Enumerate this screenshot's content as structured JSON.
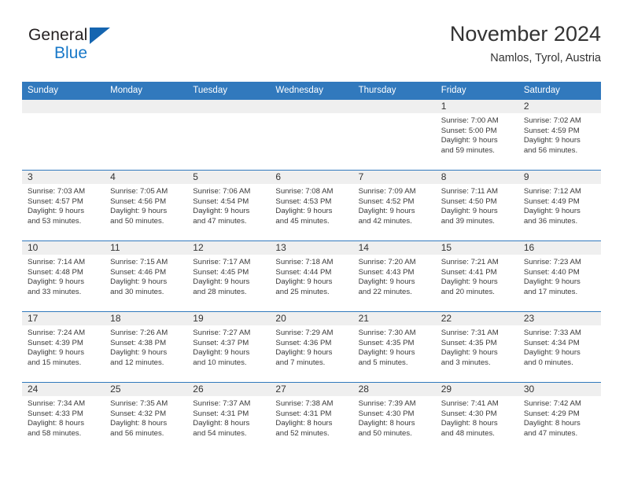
{
  "brand": {
    "name_top": "General",
    "name_bottom": "Blue",
    "triangle_icon": "triangle-icon",
    "accent_color": "#1878c8",
    "triangle_color": "#1565b0"
  },
  "header": {
    "title": "November 2024",
    "subtitle": "Namlos, Tyrol, Austria"
  },
  "calendar": {
    "header_bg_color": "#3179bd",
    "daynum_bg_color": "#efefef",
    "weekday_headers": [
      "Sunday",
      "Monday",
      "Tuesday",
      "Wednesday",
      "Thursday",
      "Friday",
      "Saturday"
    ],
    "weeks": [
      [
        {
          "day": "",
          "empty": true,
          "sunrise": "",
          "sunset": "",
          "daylight_line1": "",
          "daylight_line2": ""
        },
        {
          "day": "",
          "empty": true,
          "sunrise": "",
          "sunset": "",
          "daylight_line1": "",
          "daylight_line2": ""
        },
        {
          "day": "",
          "empty": true,
          "sunrise": "",
          "sunset": "",
          "daylight_line1": "",
          "daylight_line2": ""
        },
        {
          "day": "",
          "empty": true,
          "sunrise": "",
          "sunset": "",
          "daylight_line1": "",
          "daylight_line2": ""
        },
        {
          "day": "",
          "empty": true,
          "sunrise": "",
          "sunset": "",
          "daylight_line1": "",
          "daylight_line2": ""
        },
        {
          "day": "1",
          "empty": false,
          "sunrise": "Sunrise: 7:00 AM",
          "sunset": "Sunset: 5:00 PM",
          "daylight_line1": "Daylight: 9 hours",
          "daylight_line2": "and 59 minutes."
        },
        {
          "day": "2",
          "empty": false,
          "sunrise": "Sunrise: 7:02 AM",
          "sunset": "Sunset: 4:59 PM",
          "daylight_line1": "Daylight: 9 hours",
          "daylight_line2": "and 56 minutes."
        }
      ],
      [
        {
          "day": "3",
          "empty": false,
          "sunrise": "Sunrise: 7:03 AM",
          "sunset": "Sunset: 4:57 PM",
          "daylight_line1": "Daylight: 9 hours",
          "daylight_line2": "and 53 minutes."
        },
        {
          "day": "4",
          "empty": false,
          "sunrise": "Sunrise: 7:05 AM",
          "sunset": "Sunset: 4:56 PM",
          "daylight_line1": "Daylight: 9 hours",
          "daylight_line2": "and 50 minutes."
        },
        {
          "day": "5",
          "empty": false,
          "sunrise": "Sunrise: 7:06 AM",
          "sunset": "Sunset: 4:54 PM",
          "daylight_line1": "Daylight: 9 hours",
          "daylight_line2": "and 47 minutes."
        },
        {
          "day": "6",
          "empty": false,
          "sunrise": "Sunrise: 7:08 AM",
          "sunset": "Sunset: 4:53 PM",
          "daylight_line1": "Daylight: 9 hours",
          "daylight_line2": "and 45 minutes."
        },
        {
          "day": "7",
          "empty": false,
          "sunrise": "Sunrise: 7:09 AM",
          "sunset": "Sunset: 4:52 PM",
          "daylight_line1": "Daylight: 9 hours",
          "daylight_line2": "and 42 minutes."
        },
        {
          "day": "8",
          "empty": false,
          "sunrise": "Sunrise: 7:11 AM",
          "sunset": "Sunset: 4:50 PM",
          "daylight_line1": "Daylight: 9 hours",
          "daylight_line2": "and 39 minutes."
        },
        {
          "day": "9",
          "empty": false,
          "sunrise": "Sunrise: 7:12 AM",
          "sunset": "Sunset: 4:49 PM",
          "daylight_line1": "Daylight: 9 hours",
          "daylight_line2": "and 36 minutes."
        }
      ],
      [
        {
          "day": "10",
          "empty": false,
          "sunrise": "Sunrise: 7:14 AM",
          "sunset": "Sunset: 4:48 PM",
          "daylight_line1": "Daylight: 9 hours",
          "daylight_line2": "and 33 minutes."
        },
        {
          "day": "11",
          "empty": false,
          "sunrise": "Sunrise: 7:15 AM",
          "sunset": "Sunset: 4:46 PM",
          "daylight_line1": "Daylight: 9 hours",
          "daylight_line2": "and 30 minutes."
        },
        {
          "day": "12",
          "empty": false,
          "sunrise": "Sunrise: 7:17 AM",
          "sunset": "Sunset: 4:45 PM",
          "daylight_line1": "Daylight: 9 hours",
          "daylight_line2": "and 28 minutes."
        },
        {
          "day": "13",
          "empty": false,
          "sunrise": "Sunrise: 7:18 AM",
          "sunset": "Sunset: 4:44 PM",
          "daylight_line1": "Daylight: 9 hours",
          "daylight_line2": "and 25 minutes."
        },
        {
          "day": "14",
          "empty": false,
          "sunrise": "Sunrise: 7:20 AM",
          "sunset": "Sunset: 4:43 PM",
          "daylight_line1": "Daylight: 9 hours",
          "daylight_line2": "and 22 minutes."
        },
        {
          "day": "15",
          "empty": false,
          "sunrise": "Sunrise: 7:21 AM",
          "sunset": "Sunset: 4:41 PM",
          "daylight_line1": "Daylight: 9 hours",
          "daylight_line2": "and 20 minutes."
        },
        {
          "day": "16",
          "empty": false,
          "sunrise": "Sunrise: 7:23 AM",
          "sunset": "Sunset: 4:40 PM",
          "daylight_line1": "Daylight: 9 hours",
          "daylight_line2": "and 17 minutes."
        }
      ],
      [
        {
          "day": "17",
          "empty": false,
          "sunrise": "Sunrise: 7:24 AM",
          "sunset": "Sunset: 4:39 PM",
          "daylight_line1": "Daylight: 9 hours",
          "daylight_line2": "and 15 minutes."
        },
        {
          "day": "18",
          "empty": false,
          "sunrise": "Sunrise: 7:26 AM",
          "sunset": "Sunset: 4:38 PM",
          "daylight_line1": "Daylight: 9 hours",
          "daylight_line2": "and 12 minutes."
        },
        {
          "day": "19",
          "empty": false,
          "sunrise": "Sunrise: 7:27 AM",
          "sunset": "Sunset: 4:37 PM",
          "daylight_line1": "Daylight: 9 hours",
          "daylight_line2": "and 10 minutes."
        },
        {
          "day": "20",
          "empty": false,
          "sunrise": "Sunrise: 7:29 AM",
          "sunset": "Sunset: 4:36 PM",
          "daylight_line1": "Daylight: 9 hours",
          "daylight_line2": "and 7 minutes."
        },
        {
          "day": "21",
          "empty": false,
          "sunrise": "Sunrise: 7:30 AM",
          "sunset": "Sunset: 4:35 PM",
          "daylight_line1": "Daylight: 9 hours",
          "daylight_line2": "and 5 minutes."
        },
        {
          "day": "22",
          "empty": false,
          "sunrise": "Sunrise: 7:31 AM",
          "sunset": "Sunset: 4:35 PM",
          "daylight_line1": "Daylight: 9 hours",
          "daylight_line2": "and 3 minutes."
        },
        {
          "day": "23",
          "empty": false,
          "sunrise": "Sunrise: 7:33 AM",
          "sunset": "Sunset: 4:34 PM",
          "daylight_line1": "Daylight: 9 hours",
          "daylight_line2": "and 0 minutes."
        }
      ],
      [
        {
          "day": "24",
          "empty": false,
          "sunrise": "Sunrise: 7:34 AM",
          "sunset": "Sunset: 4:33 PM",
          "daylight_line1": "Daylight: 8 hours",
          "daylight_line2": "and 58 minutes."
        },
        {
          "day": "25",
          "empty": false,
          "sunrise": "Sunrise: 7:35 AM",
          "sunset": "Sunset: 4:32 PM",
          "daylight_line1": "Daylight: 8 hours",
          "daylight_line2": "and 56 minutes."
        },
        {
          "day": "26",
          "empty": false,
          "sunrise": "Sunrise: 7:37 AM",
          "sunset": "Sunset: 4:31 PM",
          "daylight_line1": "Daylight: 8 hours",
          "daylight_line2": "and 54 minutes."
        },
        {
          "day": "27",
          "empty": false,
          "sunrise": "Sunrise: 7:38 AM",
          "sunset": "Sunset: 4:31 PM",
          "daylight_line1": "Daylight: 8 hours",
          "daylight_line2": "and 52 minutes."
        },
        {
          "day": "28",
          "empty": false,
          "sunrise": "Sunrise: 7:39 AM",
          "sunset": "Sunset: 4:30 PM",
          "daylight_line1": "Daylight: 8 hours",
          "daylight_line2": "and 50 minutes."
        },
        {
          "day": "29",
          "empty": false,
          "sunrise": "Sunrise: 7:41 AM",
          "sunset": "Sunset: 4:30 PM",
          "daylight_line1": "Daylight: 8 hours",
          "daylight_line2": "and 48 minutes."
        },
        {
          "day": "30",
          "empty": false,
          "sunrise": "Sunrise: 7:42 AM",
          "sunset": "Sunset: 4:29 PM",
          "daylight_line1": "Daylight: 8 hours",
          "daylight_line2": "and 47 minutes."
        }
      ]
    ]
  }
}
